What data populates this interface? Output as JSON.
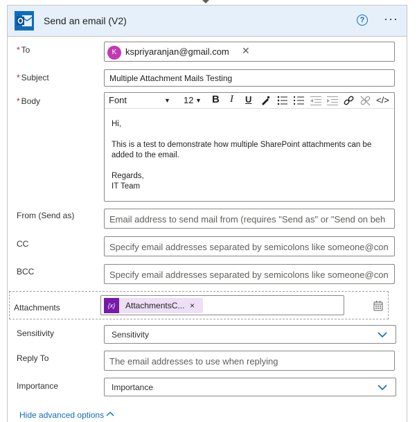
{
  "header": {
    "title": "Send an email (V2)",
    "help_glyph": "?",
    "more_glyph": "···"
  },
  "to": {
    "label": "To",
    "required": "*",
    "recipient_initial": "K",
    "recipient": "kspriyaranjan@gmail.com",
    "remove_glyph": "✕"
  },
  "subject": {
    "label": "Subject",
    "required": "*",
    "value": "Multiple Attachment Mails Testing"
  },
  "body": {
    "label": "Body",
    "required": "*",
    "toolbar": {
      "font": "Font",
      "size": "12",
      "bold": "B",
      "italic": "I",
      "underline": "U",
      "code": "</>"
    },
    "lines": [
      "Hi,",
      "",
      "This is a test to demonstrate how multiple SharePoint attachments can be",
      "added to the email.",
      "",
      "Regards,",
      "IT Team"
    ]
  },
  "from": {
    "label": "From (Send as)",
    "placeholder": "Email address to send mail from (requires \"Send as\" or \"Send on beh"
  },
  "cc": {
    "label": "CC",
    "placeholder": "Specify email addresses separated by semicolons like someone@con"
  },
  "bcc": {
    "label": "BCC",
    "placeholder": "Specify email addresses separated by semicolons like someone@con"
  },
  "attachments": {
    "label": "Attachments",
    "chip_icon": "{x}",
    "chip_text": "AttachmentsC...",
    "chip_remove": "×"
  },
  "sensitivity": {
    "label": "Sensitivity",
    "value": "Sensitivity"
  },
  "reply_to": {
    "label": "Reply To",
    "placeholder": "The email addresses to use when replying"
  },
  "importance": {
    "label": "Importance",
    "value": "Importance"
  },
  "footer": {
    "hide_advanced": "Hide advanced options"
  },
  "colors": {
    "accent": "#0f6cbd",
    "header_bg": "#e5f0fb",
    "required": "#a4262c",
    "chip_bg": "#ede0f6",
    "chip_icon": "#7719aa",
    "avatar": "#c239b3"
  }
}
